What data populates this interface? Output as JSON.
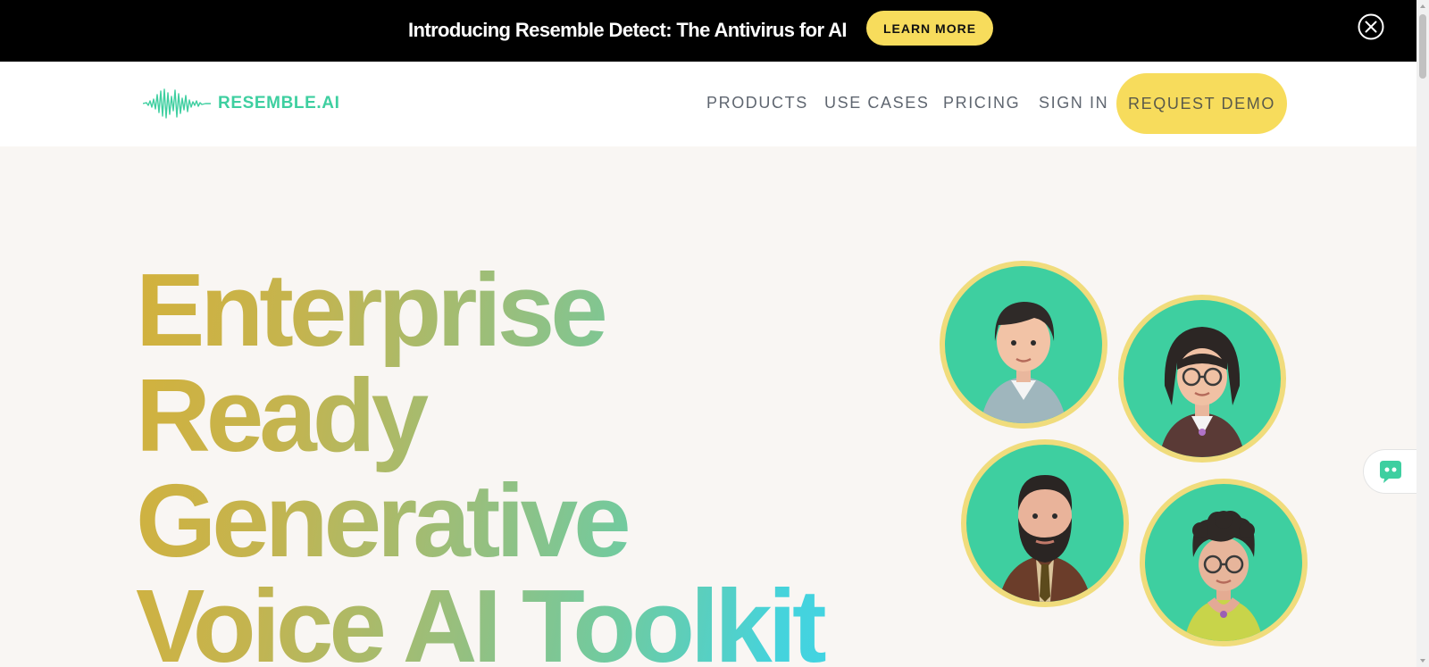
{
  "announcement": {
    "text": "Introducing Resemble Detect: The Antivirus for AI",
    "button_label": "LEARN MORE",
    "close_icon": "close-circle-icon"
  },
  "header": {
    "logo_text": "RESEMBLE.AI",
    "logo_icon": "waveform-icon",
    "nav": [
      {
        "label": "PRODUCTS"
      },
      {
        "label": "USE CASES"
      },
      {
        "label": "PRICING"
      },
      {
        "label": "SIGN IN"
      }
    ],
    "cta_label": "REQUEST DEMO"
  },
  "hero": {
    "title_lines": [
      "Enterprise",
      "Ready",
      "Generative",
      "Voice AI Toolkit"
    ]
  },
  "avatars": [
    {
      "name": "avatar-man-hair",
      "icon": "play-icon"
    },
    {
      "name": "avatar-woman-braids",
      "icon": "play-icon"
    },
    {
      "name": "avatar-man-beard",
      "icon": "play-icon"
    },
    {
      "name": "avatar-woman-curly",
      "icon": "play-icon"
    }
  ],
  "chat_widget": {
    "icon": "chat-bot-icon"
  },
  "colors": {
    "accent_yellow": "#f7dc5c",
    "brand_green": "#3ecfa0",
    "announce_bg": "#000000",
    "page_bg": "#f9f6f3"
  }
}
